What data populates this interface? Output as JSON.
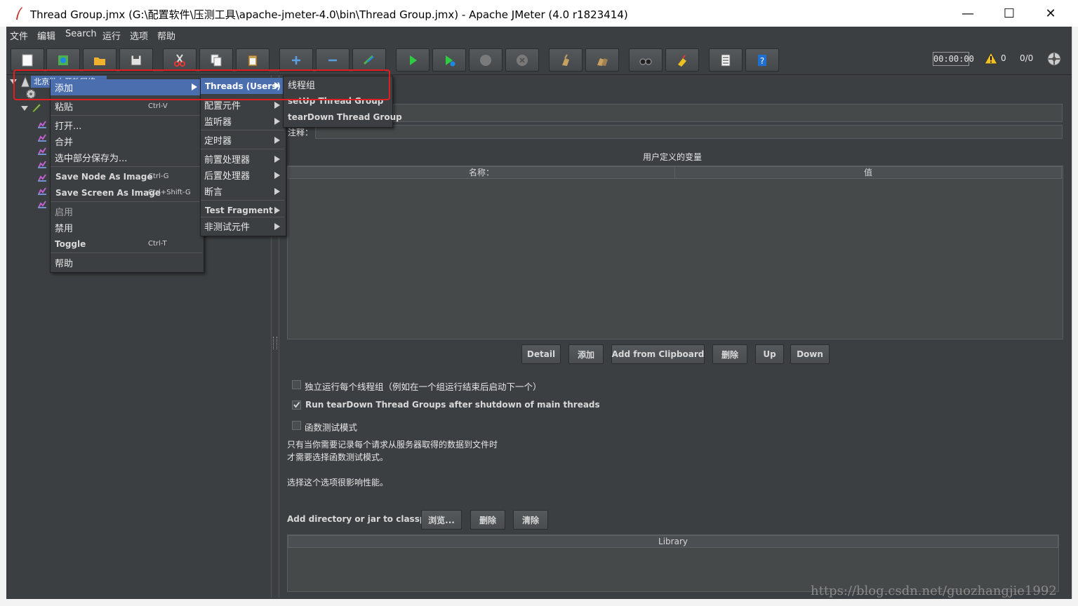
{
  "window": {
    "title": "Thread Group.jmx (G:\\配置软件\\压测工具\\apache-jmeter-4.0\\bin\\Thread Group.jmx) - Apache JMeter (4.0 r1823414)",
    "minimize": "—",
    "maximize": "☐",
    "close": "✕"
  },
  "menubar": [
    "文件",
    "编辑",
    "Search",
    "运行",
    "选项",
    "帮助"
  ],
  "toolbar": {
    "icons": [
      "new-icon",
      "templates-icon",
      "open-icon",
      "save-icon",
      "cut-icon",
      "copy-icon",
      "paste-icon",
      "expand-icon",
      "collapse-icon",
      "toggle-icon",
      "start-icon",
      "start-no-timers-icon",
      "stop-icon",
      "shutdown-icon",
      "clear-icon",
      "clear-all-icon",
      "search-icon",
      "reset-search-icon",
      "function-helper-icon",
      "help-icon"
    ],
    "timer": "00:00:00",
    "warning_count": "0",
    "thread_ratio": "0/0"
  },
  "tree": {
    "root_label": "北京批上开放网络"
  },
  "context_menu": {
    "items": [
      {
        "label": "添加",
        "shortcut": ""
      },
      {
        "label": "粘贴",
        "shortcut": "Ctrl-V"
      },
      {
        "label": "打开...",
        "shortcut": ""
      },
      {
        "label": "合并",
        "shortcut": ""
      },
      {
        "label": "选中部分保存为...",
        "shortcut": ""
      },
      {
        "label": "Save Node As Image",
        "shortcut": "Ctrl-G"
      },
      {
        "label": "Save Screen As Image",
        "shortcut": "Ctrl+Shift-G"
      },
      {
        "label": "启用",
        "shortcut": ""
      },
      {
        "label": "禁用",
        "shortcut": ""
      },
      {
        "label": "Toggle",
        "shortcut": "Ctrl-T"
      },
      {
        "label": "帮助",
        "shortcut": ""
      }
    ]
  },
  "add_submenu": {
    "items": [
      "Threads (Users)",
      "配置元件",
      "监听器",
      "定时器",
      "前置处理器",
      "后置处理器",
      "断言",
      "Test Fragment",
      "非测试元件"
    ]
  },
  "threads_submenu": {
    "items": [
      "线程组",
      "setUp Thread Group",
      "tearDown Thread Group"
    ]
  },
  "main": {
    "comment_label": "注释：",
    "variables_title": "用户定义的变量",
    "col_name": "名称：",
    "col_value": "值",
    "buttons": [
      "Detail",
      "添加",
      "Add from Clipboard",
      "删除",
      "Up",
      "Down"
    ],
    "opt_serial": "独立运行每个线程组（例如在一个组运行结束后启动下一个）",
    "opt_teardown": "Run tearDown Thread Groups after shutdown of main threads",
    "opt_functional": "函数测试模式",
    "note_line1": "只有当你需要记录每个请求从服务器取得的数据到文件时",
    "note_line2": "才需要选择函数测试模式。",
    "note_line3": "选择这个选项很影响性能。",
    "classpath_label": "Add directory or jar to classpath",
    "classpath_buttons": [
      "浏览...",
      "删除",
      "清除"
    ],
    "library_header": "Library"
  },
  "options_state": {
    "serial": false,
    "teardown": true,
    "functional": false
  },
  "watermark": "https://blog.csdn.net/guozhangjie1992",
  "colors": {
    "background": "#3c3f41",
    "selection": "#4b6eaf",
    "highlight_box": "#e02020"
  }
}
